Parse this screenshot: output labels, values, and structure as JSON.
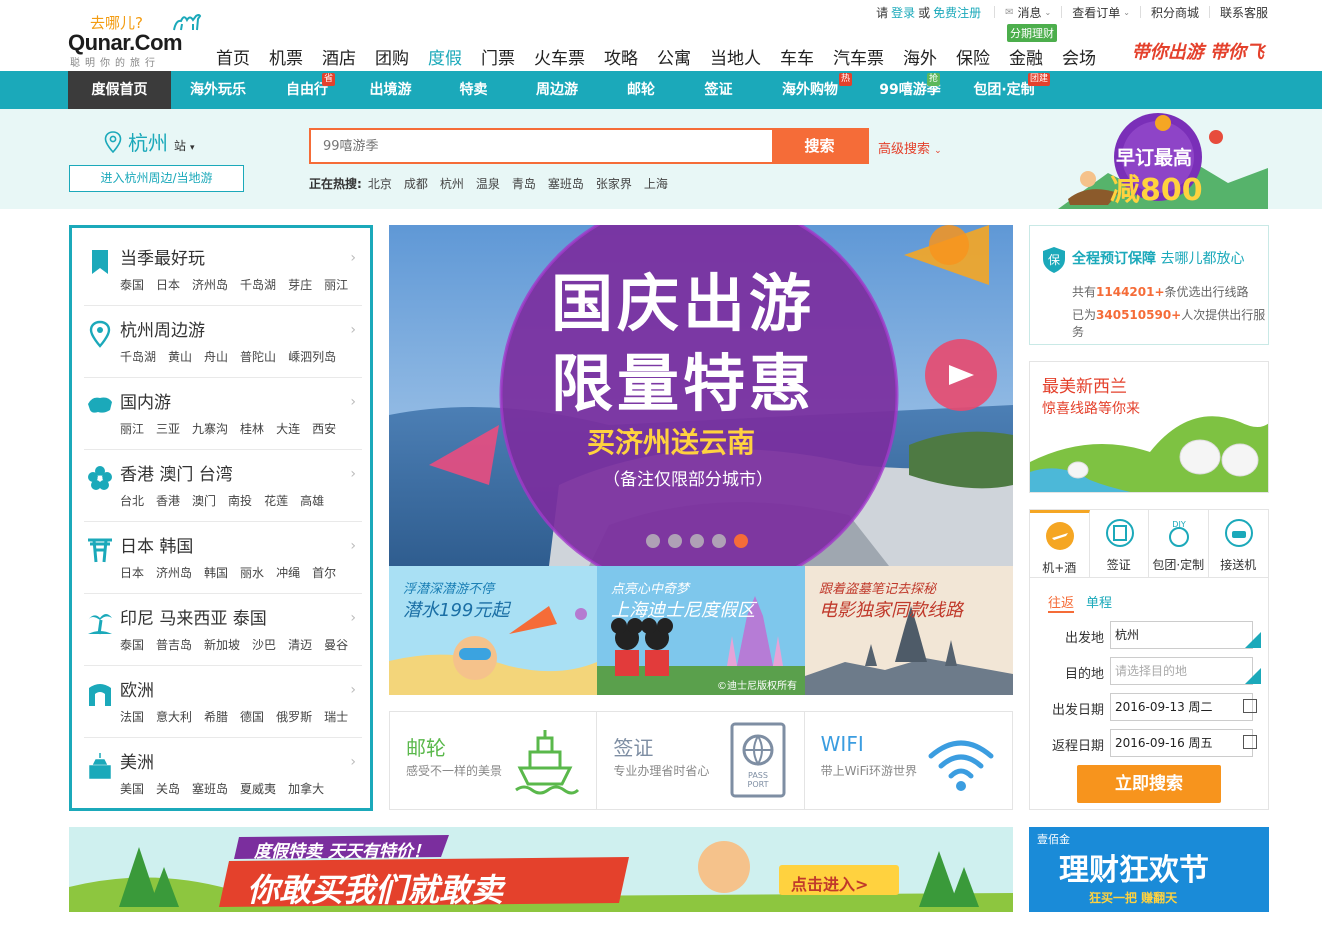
{
  "logo": {
    "cn": "去哪儿?",
    "en": "Qunar.Com",
    "slogan": "聪明你的旅行"
  },
  "toplinks": {
    "please": "请",
    "login": "登录",
    "or": "或",
    "register": "免费注册",
    "messages": "消息",
    "orders": "查看订单",
    "mall": "积分商城",
    "service": "联系客服"
  },
  "mainnav": {
    "items": [
      "首页",
      "机票",
      "酒店",
      "团购",
      "度假",
      "门票",
      "火车票",
      "攻略",
      "公寓",
      "当地人",
      "车车",
      "汽车票",
      "海外",
      "保险",
      "金融",
      "会场"
    ],
    "active_index": 4,
    "finance_badge": "分期理财"
  },
  "slogan_right": "带你出游 带你飞",
  "subnav": {
    "items": [
      {
        "label": "度假首页",
        "tag": ""
      },
      {
        "label": "海外玩乐",
        "tag": ""
      },
      {
        "label": "自由行",
        "tag": "省"
      },
      {
        "label": "出境游",
        "tag": ""
      },
      {
        "label": "特卖",
        "tag": ""
      },
      {
        "label": "周边游",
        "tag": ""
      },
      {
        "label": "邮轮",
        "tag": ""
      },
      {
        "label": "签证",
        "tag": ""
      },
      {
        "label": "海外购物",
        "tag": "热"
      },
      {
        "label": "99嘻游季",
        "tag": "抢"
      },
      {
        "label": "包团·定制",
        "tag": "团建"
      }
    ]
  },
  "city": {
    "name": "杭州",
    "suffix": "站",
    "nearby_button": "进入杭州周边/当地游"
  },
  "search": {
    "placeholder": "99嘻游季",
    "button": "搜索",
    "advanced": "高级搜索"
  },
  "hot": {
    "label": "正在热搜:",
    "cities": [
      "北京",
      "成都",
      "杭州",
      "温泉",
      "青岛",
      "塞班岛",
      "张家界",
      "上海"
    ]
  },
  "promo_ad": {
    "line1": "早订最高",
    "line2": "减800"
  },
  "categories": [
    {
      "title": "当季最好玩",
      "subs": [
        "泰国",
        "日本",
        "济州岛",
        "千岛湖",
        "芽庄",
        "丽江"
      ]
    },
    {
      "title": "杭州周边游",
      "subs": [
        "千岛湖",
        "黄山",
        "舟山",
        "普陀山",
        "嵊泗列岛"
      ]
    },
    {
      "title": "国内游",
      "subs": [
        "丽江",
        "三亚",
        "九寨沟",
        "桂林",
        "大连",
        "西安"
      ]
    },
    {
      "title": "香港 澳门 台湾",
      "subs": [
        "台北",
        "香港",
        "澳门",
        "南投",
        "花莲",
        "高雄"
      ]
    },
    {
      "title": "日本 韩国",
      "subs": [
        "日本",
        "济州岛",
        "韩国",
        "丽水",
        "冲绳",
        "首尔"
      ]
    },
    {
      "title": "印尼 马来西亚 泰国",
      "subs": [
        "泰国",
        "普吉岛",
        "新加坡",
        "沙巴",
        "清迈",
        "曼谷"
      ]
    },
    {
      "title": "欧洲",
      "subs": [
        "法国",
        "意大利",
        "希腊",
        "德国",
        "俄罗斯",
        "瑞士"
      ]
    },
    {
      "title": "美洲",
      "subs": [
        "美国",
        "关岛",
        "塞班岛",
        "夏威夷",
        "加拿大"
      ]
    }
  ],
  "banner": {
    "line1": "国庆出游",
    "line2": "限量特惠",
    "line3": "买济州送云南",
    "note": "（备注仅限部分城市）"
  },
  "minis": [
    {
      "t1": "浮潜深潜游不停",
      "t2": "潜水199元起",
      "credit": ""
    },
    {
      "t1": "点亮心中奇梦",
      "t2": "上海迪士尼度假区",
      "credit": "©迪士尼版权所有"
    },
    {
      "t1": "跟着盗墓笔记去探秘",
      "t2": "电影独家同款线路",
      "credit": ""
    }
  ],
  "services": [
    {
      "title": "邮轮",
      "desc": "感受不一样的美景"
    },
    {
      "title": "签证",
      "desc": "专业办理省时省心"
    },
    {
      "title": "WIFI",
      "desc": "带上WiFi环游世界"
    }
  ],
  "guarantee": {
    "title_bold": "全程预订保障",
    "title_rest": " 去哪儿都放心",
    "line1_pre": "共有",
    "line1_num": "1144201+",
    "line1_post": "条优选出行线路",
    "line2_pre": "已为",
    "line2_num": "340510590+",
    "line2_post": "人次提供出行服务"
  },
  "nz": {
    "title": "最美新西兰",
    "sub": "惊喜线路等你来"
  },
  "booking": {
    "tabs": [
      "机+酒",
      "签证",
      "包团·定制",
      "接送机"
    ],
    "modes": [
      "往返",
      "单程"
    ],
    "from_label": "出发地",
    "from_value": "杭州",
    "to_label": "目的地",
    "to_placeholder": "请选择目的地",
    "depart_label": "出发日期",
    "depart_value": "2016-09-13 周二",
    "return_label": "返程日期",
    "return_value": "2016-09-16 周五",
    "submit": "立即搜索"
  },
  "bottom_banner": {
    "top": "度假特卖 天天有特价！",
    "main": "你敢买我们就敢卖",
    "cta": "点击进入>"
  },
  "bottom_right": {
    "brand": "壹佰金",
    "main": "理财狂欢节",
    "sub": "狂买一把 赚翻天"
  }
}
